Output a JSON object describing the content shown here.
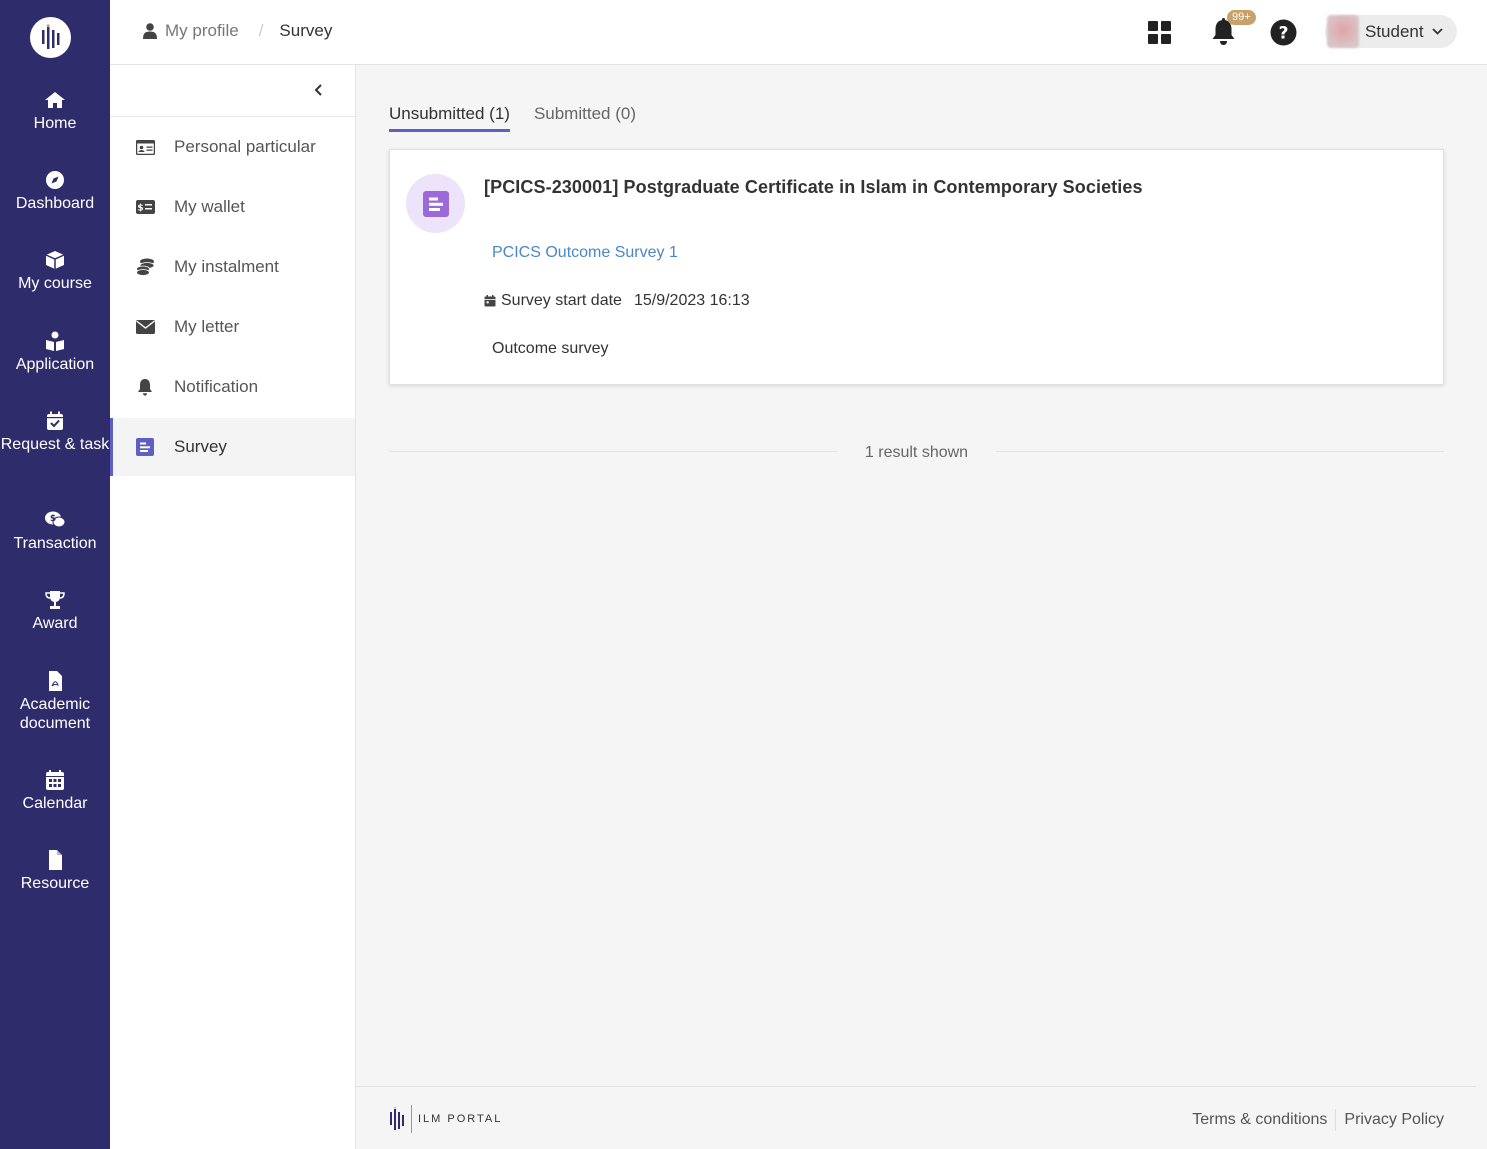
{
  "nav": {
    "items": [
      {
        "label": "Home",
        "icon": "home-icon"
      },
      {
        "label": "Dashboard",
        "icon": "compass-icon"
      },
      {
        "label": "My course",
        "icon": "cube-icon"
      },
      {
        "label": "Application",
        "icon": "reader-icon"
      },
      {
        "label": "Request & task",
        "icon": "calendar-check-icon"
      },
      {
        "label": "Transaction",
        "icon": "money-chat-icon"
      },
      {
        "label": "Award",
        "icon": "trophy-icon"
      },
      {
        "label": "Academic document",
        "icon": "pdf-file-icon"
      },
      {
        "label": "Calendar",
        "icon": "calendar-icon"
      },
      {
        "label": "Resource",
        "icon": "file-icon"
      }
    ]
  },
  "breadcrumb": {
    "profile": "My profile",
    "current": "Survey"
  },
  "topbar": {
    "notification_badge": "99+",
    "user_role": "Student"
  },
  "profile_menu": {
    "items": [
      {
        "label": "Personal particular",
        "icon": "id-card-icon"
      },
      {
        "label": "My wallet",
        "icon": "wallet-card-icon"
      },
      {
        "label": "My instalment",
        "icon": "coins-icon"
      },
      {
        "label": "My letter",
        "icon": "envelope-icon"
      },
      {
        "label": "Notification",
        "icon": "bell-icon"
      },
      {
        "label": "Survey",
        "icon": "survey-icon",
        "active": true
      }
    ]
  },
  "tabs": [
    {
      "label": "Unsubmitted (1)",
      "active": true
    },
    {
      "label": "Submitted (0)",
      "active": false
    }
  ],
  "survey_card": {
    "title": "[PCICS-230001] Postgraduate Certificate in Islam in Contemporary Societies",
    "link": "PCICS Outcome Survey 1",
    "start_date_label": "Survey start date",
    "start_date_value": "15/9/2023 16:13",
    "description": "Outcome survey"
  },
  "results_text": "1 result shown",
  "footer": {
    "brand": "ILM PORTAL",
    "terms": "Terms & conditions",
    "privacy": "Privacy Policy"
  },
  "colors": {
    "nav_bg": "#2e2c6b",
    "accent": "#5d5fc2",
    "link": "#4a86c8",
    "survey_icon_bg": "#ede3fa",
    "survey_icon": "#9b6ad8",
    "badge": "#c8a16a"
  }
}
